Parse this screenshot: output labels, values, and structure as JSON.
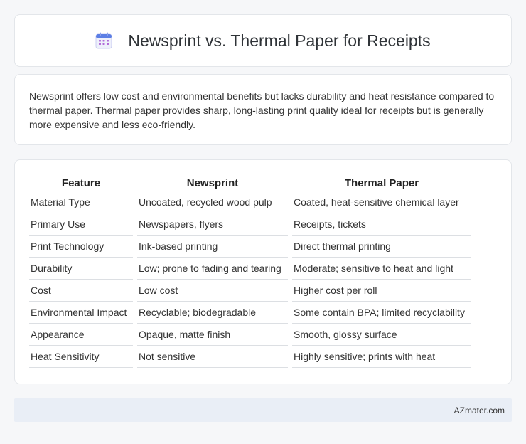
{
  "header": {
    "icon": "calendar-icon",
    "title": "Newsprint vs. Thermal Paper for Receipts"
  },
  "summary": {
    "text": "Newsprint offers low cost and environmental benefits but lacks durability and heat resistance compared to thermal paper. Thermal paper provides sharp, long-lasting print quality ideal for receipts but is generally more expensive and less eco-friendly."
  },
  "table": {
    "columns": [
      "Feature",
      "Newsprint",
      "Thermal Paper"
    ],
    "rows": [
      [
        "Material Type",
        "Uncoated, recycled wood pulp",
        "Coated, heat-sensitive chemical layer"
      ],
      [
        "Primary Use",
        "Newspapers, flyers",
        "Receipts, tickets"
      ],
      [
        "Print Technology",
        "Ink-based printing",
        "Direct thermal printing"
      ],
      [
        "Durability",
        "Low; prone to fading and tearing",
        "Moderate; sensitive to heat and light"
      ],
      [
        "Cost",
        "Low cost",
        "Higher cost per roll"
      ],
      [
        "Environmental Impact",
        "Recyclable; biodegradable",
        "Some contain BPA; limited recyclability"
      ],
      [
        "Appearance",
        "Opaque, matte finish",
        "Smooth, glossy surface"
      ],
      [
        "Heat Sensitivity",
        "Not sensitive",
        "Highly sensitive; prints with heat"
      ]
    ]
  },
  "footer": {
    "brand": "AZmater.com"
  },
  "colors": {
    "icon_top": "#5b7ee5",
    "icon_grid": "#b06ad8",
    "footer_bg": "#e9eef6"
  }
}
